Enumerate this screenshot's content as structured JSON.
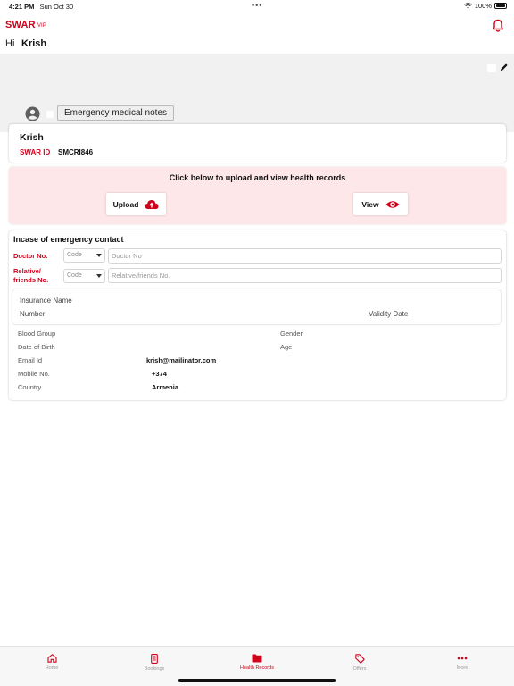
{
  "status_bar": {
    "time": "4:21 PM",
    "date": "Sun Oct 30",
    "dots": "•••",
    "battery": "100%"
  },
  "header": {
    "brand": "SWAR",
    "brand_suffix": "VIP",
    "accent_color": "#d0021b",
    "notification_icon": "bell-icon"
  },
  "greeting": {
    "hi": "Hi",
    "name": "Krish"
  },
  "profile": {
    "emergency_button": "Emergency medical notes",
    "edit_icon": "pencil-icon",
    "avatar_icon": "user-circle-icon"
  },
  "id_card": {
    "name": "Krish",
    "id_label": "SWAR ID",
    "id_value": "SMCRI846"
  },
  "records": {
    "headline": "Click below to upload and view health records",
    "upload_label": "Upload",
    "view_label": "View",
    "upload_icon": "cloud-upload-icon",
    "view_icon": "eye-icon"
  },
  "emergency": {
    "title": "Incase of emergency contact",
    "doctor_label": "Doctor No.",
    "doctor_code_placeholder": "Code",
    "doctor_placeholder": "Doctor No",
    "relative_label_line1": "Relative/",
    "relative_label_line2": "friends No.",
    "relative_code_placeholder": "Code",
    "relative_placeholder": "Relative/friends No."
  },
  "insurance": {
    "name_label": "Insurance Name",
    "number_label": "Number",
    "validity_label": "Validity Date"
  },
  "details": {
    "blood_group_label": "Blood Group",
    "gender_label": "Gender",
    "dob_label": "Date of Birth",
    "age_label": "Age",
    "email_label": "Email Id",
    "email_value": "krish@mailinator.com",
    "mobile_label": "Mobile No.",
    "mobile_value": "+374",
    "country_label": "Country",
    "country_value": "Armenia"
  },
  "tabs": [
    {
      "label": "Home",
      "icon": "home-icon",
      "active": false
    },
    {
      "label": "Bookings",
      "icon": "phone-icon",
      "active": false
    },
    {
      "label": "Health Records",
      "icon": "folder-icon",
      "active": true
    },
    {
      "label": "Offers",
      "icon": "tag-icon",
      "active": false
    },
    {
      "label": "More",
      "icon": "more-icon",
      "active": false
    }
  ]
}
